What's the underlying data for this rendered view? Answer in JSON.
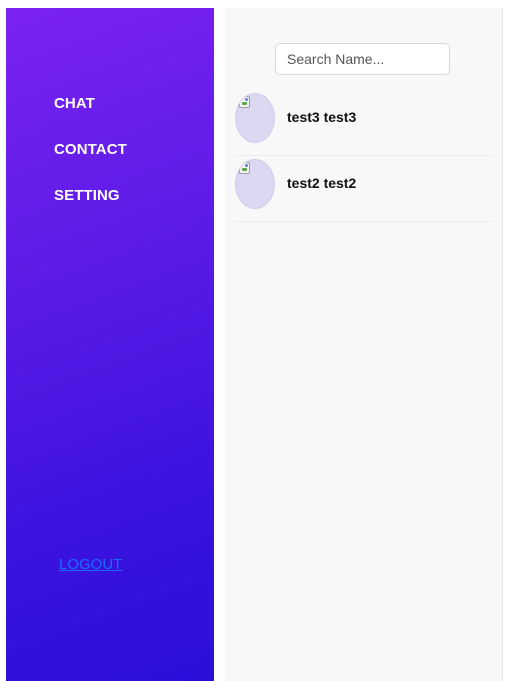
{
  "sidebar": {
    "nav": [
      {
        "label": "CHAT"
      },
      {
        "label": "CONTACT"
      },
      {
        "label": "SETTING"
      }
    ],
    "logout_label": "LOGOUT",
    "gradient": {
      "from": "#7b22f2",
      "to": "#2a0fd9"
    },
    "logout_color": "#1e6bff"
  },
  "panel": {
    "search": {
      "placeholder": "Search Name...",
      "value": ""
    },
    "contacts": [
      {
        "name": "test3 test3",
        "avatar_icon": "broken-image-icon"
      },
      {
        "name": "test2 test2",
        "avatar_icon": "broken-image-icon"
      }
    ]
  }
}
